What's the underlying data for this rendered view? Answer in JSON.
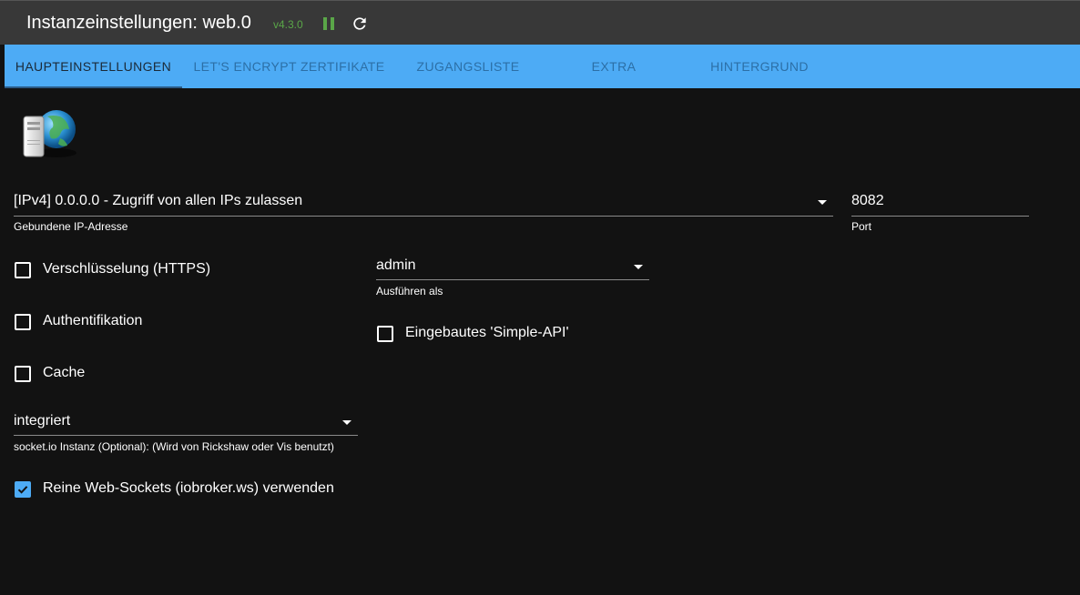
{
  "header": {
    "title": "Instanzeinstellungen: web.0",
    "version": "v4.3.0",
    "pause_icon": "pause-icon",
    "reload_icon": "reload-icon"
  },
  "tabs": [
    {
      "label": "HAUPTEINSTELLUNGEN",
      "active": true
    },
    {
      "label": "LET'S ENCRYPT ZERTIFIKATE",
      "active": false
    },
    {
      "label": "ZUGANGSLISTE",
      "active": false
    },
    {
      "label": "EXTRA",
      "active": false
    },
    {
      "label": "HINTERGRUND",
      "active": false
    }
  ],
  "colors": {
    "accent": "#4dabf5",
    "version": "#5aa648",
    "background": "#121212",
    "titlebar": "#383838"
  },
  "form": {
    "bind_ip": {
      "value": "[IPv4] 0.0.0.0 - Zugriff von allen IPs zulassen",
      "label": "Gebundene IP-Adresse"
    },
    "port": {
      "value": "8082",
      "label": "Port"
    },
    "run_as": {
      "value": "admin",
      "label": "Ausführen als"
    },
    "socketio": {
      "value": "integriert",
      "label": "socket.io Instanz (Optional): (Wird von Rickshaw oder Vis benutzt)"
    },
    "https": {
      "label": "Verschlüsselung (HTTPS)",
      "checked": false
    },
    "auth": {
      "label": "Authentifikation",
      "checked": false
    },
    "cache": {
      "label": "Cache",
      "checked": false
    },
    "simple_api": {
      "label": "Eingebautes 'Simple-API'",
      "checked": false
    },
    "pure_ws": {
      "label": "Reine Web-Sockets (iobroker.ws) verwenden",
      "checked": true
    }
  }
}
